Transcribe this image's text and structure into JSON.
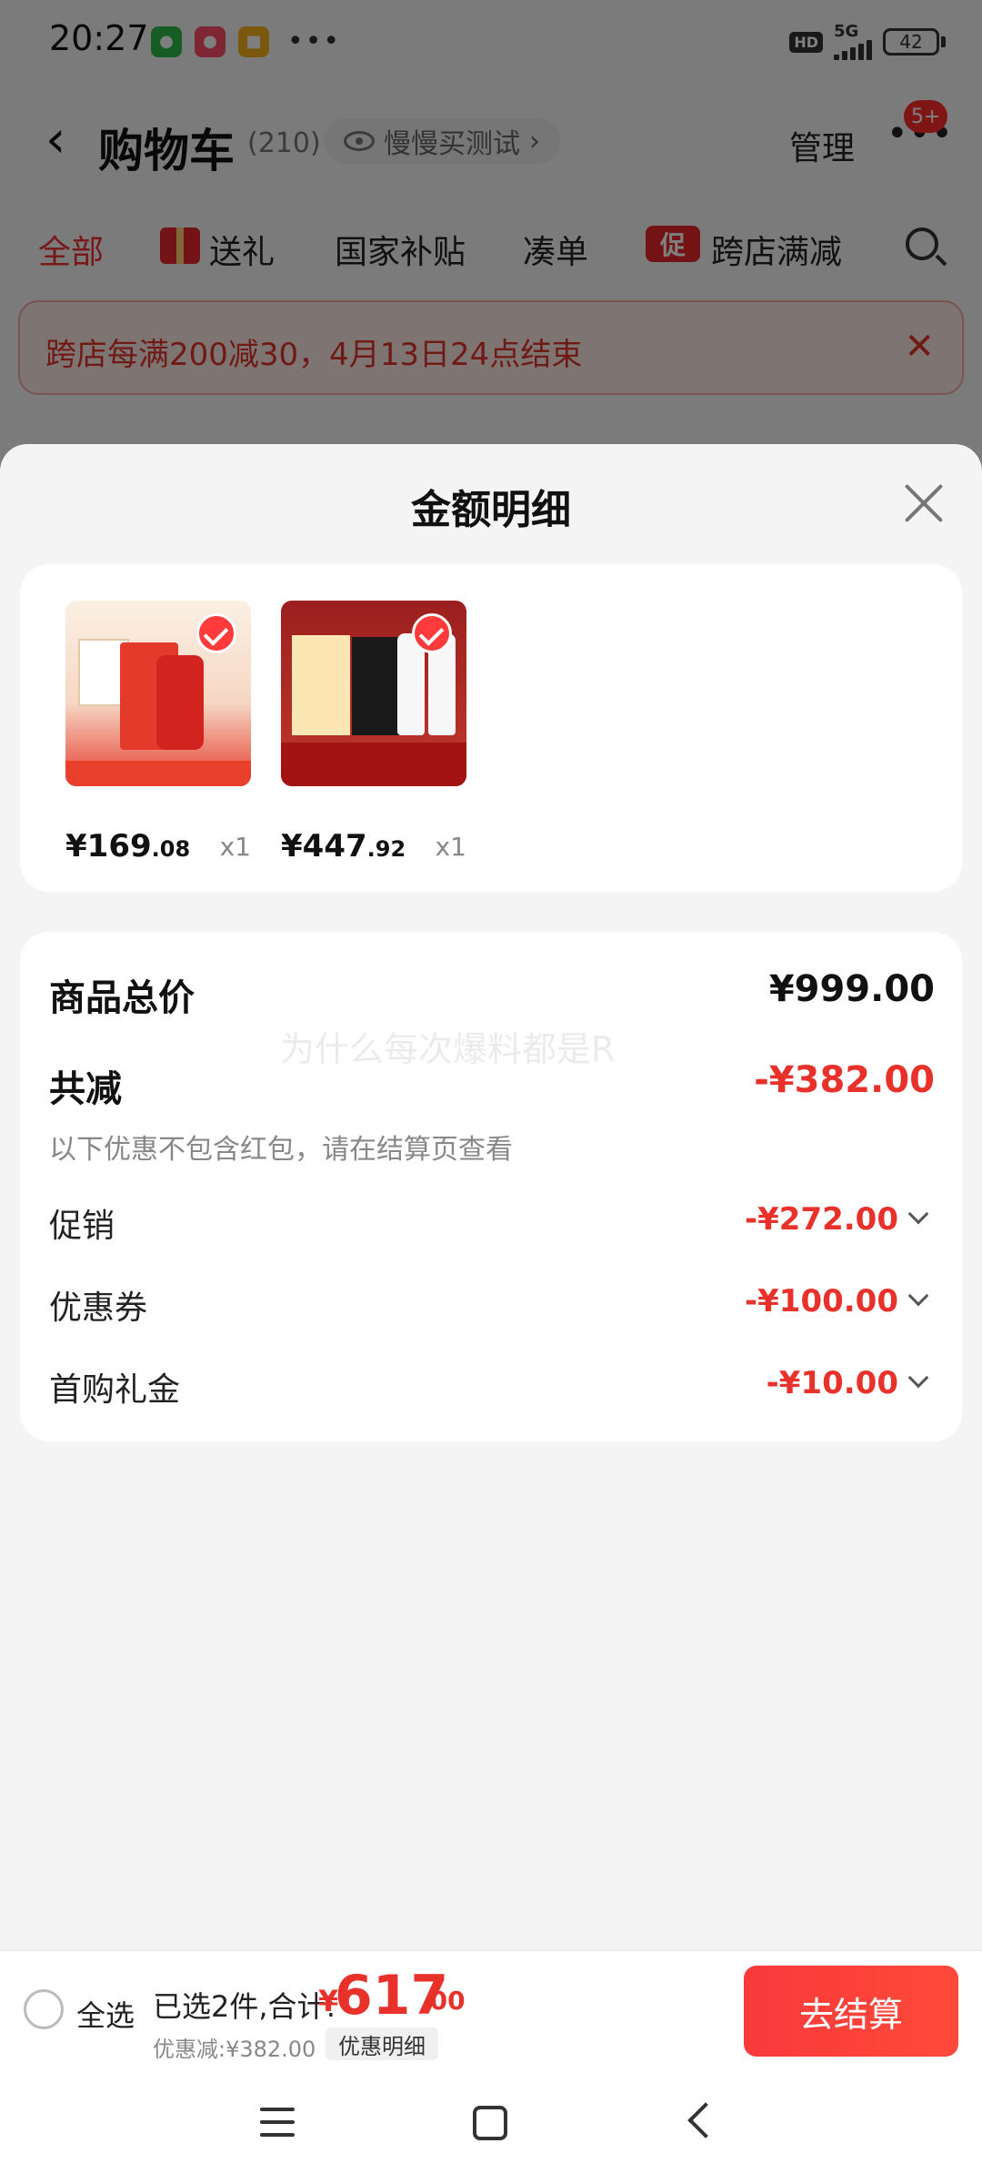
{
  "status_bar": {
    "time": "20:27",
    "network": "5G",
    "hd": "HD",
    "battery": "42"
  },
  "nav": {
    "title": "购物车",
    "count": "(210)",
    "pill": "慢慢买测试",
    "manage": "管理",
    "badge": "5+"
  },
  "tabs": [
    "全部",
    "送礼",
    "国家补贴",
    "凑单",
    "跨店满减"
  ],
  "tab_icon_cu": "促",
  "promo": {
    "text": "跨店每满200减30，4月13日24点结束"
  },
  "sheet": {
    "title": "金额明细",
    "products": [
      {
        "price_int": "¥169",
        "price_dec": ".08",
        "qty": "x1"
      },
      {
        "price_int": "¥447",
        "price_dec": ".92",
        "qty": "x1"
      }
    ],
    "summary": {
      "total_label": "商品总价",
      "total_value": "¥999.00",
      "reduce_label": "共减",
      "reduce_value": "-¥382.00",
      "note": "以下优惠不包含红包，请在结算页查看",
      "items": [
        {
          "label": "促销",
          "value": "-¥272.00"
        },
        {
          "label": "优惠券",
          "value": "-¥100.00"
        },
        {
          "label": "首购礼金",
          "value": "-¥10.00"
        }
      ]
    },
    "watermark": "为什么每次爆料都是R"
  },
  "checkout": {
    "select_all": "全选",
    "selected": "已选2件,合计:",
    "currency": "¥",
    "total_int": "617",
    "total_dec": ".00",
    "discount": "优惠减:¥382.00",
    "detail": "优惠明细",
    "button": "去结算"
  },
  "colors": {
    "accent": "#e8312a",
    "button": "#f8393b"
  }
}
